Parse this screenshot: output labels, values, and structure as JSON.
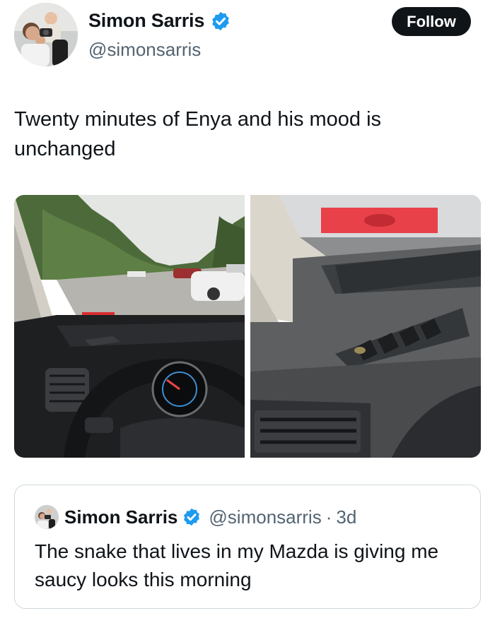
{
  "author": {
    "display_name": "Simon Sarris",
    "handle": "@simonsarris",
    "avatar_icon": "profile-avatar",
    "verified_icon": "verified-badge-icon"
  },
  "follow_label": "Follow",
  "tweet": {
    "text": "Twenty minutes of Enya and his mood is unchanged"
  },
  "media": [
    {
      "name": "car-interior-photo-parking-lot"
    },
    {
      "name": "car-dashboard-vent-photo"
    }
  ],
  "quoted_tweet": {
    "display_name": "Simon Sarris",
    "handle": "@simonsarris",
    "separator": "·",
    "time": "3d",
    "text": "The snake that lives in my Mazda is giving me saucy looks this morning"
  },
  "colors": {
    "text": "#0f1419",
    "secondary": "#536471",
    "verified": "#1d9bf0",
    "button": "#0f1419",
    "border": "#cfd9de"
  }
}
